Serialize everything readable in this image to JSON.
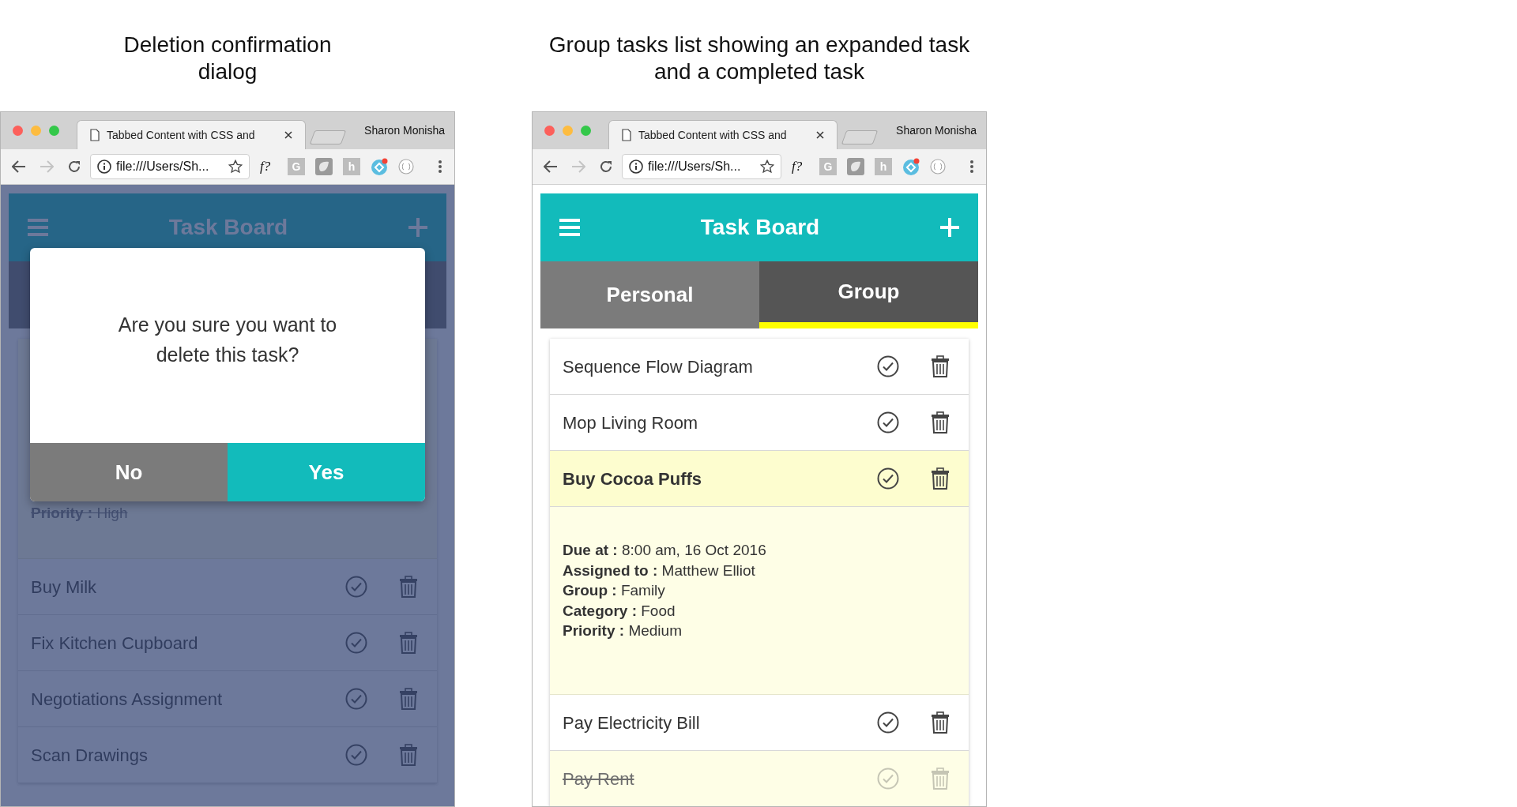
{
  "panels": [
    {
      "caption": "Deletion confirmation dialog",
      "browser": {
        "tab_title": "Tabbed Content with CSS and",
        "profile": "Sharon Monisha",
        "address": "file:///Users/Sh...",
        "extensions": [
          {
            "kind": "text",
            "label": "f?"
          },
          {
            "kind": "tile",
            "label": "G"
          },
          {
            "kind": "shape"
          },
          {
            "kind": "tile",
            "label": "h"
          },
          {
            "kind": "badge"
          },
          {
            "kind": "braces"
          }
        ]
      },
      "app": {
        "title": "Task Board",
        "tasks": [
          {
            "kind": "details",
            "completed": true,
            "details": [
              "**Priority :** High"
            ]
          },
          {
            "kind": "task",
            "title": "Buy Milk",
            "expanded": false,
            "completed": false
          },
          {
            "kind": "task",
            "title": "Fix Kitchen Cupboard",
            "expanded": false,
            "completed": false
          },
          {
            "kind": "task",
            "title": "Negotiations Assignment",
            "expanded": false,
            "completed": false
          },
          {
            "kind": "task",
            "title": "Scan Drawings",
            "expanded": false,
            "completed": false
          }
        ]
      },
      "dialog": {
        "message": "Are you sure you want to delete this task?",
        "buttons": [
          {
            "label": "No",
            "kind": "cancel"
          },
          {
            "label": "Yes",
            "kind": "confirm"
          }
        ]
      }
    },
    {
      "caption": "Group tasks list showing an expanded task and a completed task",
      "browser": {
        "tab_title": "Tabbed Content with CSS and",
        "profile": "Sharon Monisha",
        "address": "file:///Users/Sh...",
        "extensions": [
          {
            "kind": "text",
            "label": "f?"
          },
          {
            "kind": "tile",
            "label": "G"
          },
          {
            "kind": "shape"
          },
          {
            "kind": "tile",
            "label": "h"
          },
          {
            "kind": "badge"
          },
          {
            "kind": "braces"
          }
        ]
      },
      "app": {
        "title": "Task Board",
        "tabs": [
          {
            "label": "Personal",
            "selected": false
          },
          {
            "label": "Group",
            "selected": true
          }
        ],
        "tasks": [
          {
            "kind": "task",
            "title": "Sequence Flow Diagram",
            "expanded": false,
            "completed": false
          },
          {
            "kind": "task",
            "title": "Mop Living Room",
            "expanded": false,
            "completed": false
          },
          {
            "kind": "task",
            "title": "Buy Cocoa Puffs",
            "expanded": true,
            "completed": false,
            "details": [
              "**Due at :** 8:00 am, 16 Oct 2016",
              "**Assigned to :** Matthew Elliot",
              "**Group :** Family",
              "**Category :** Food",
              "**Priority :** Medium"
            ]
          },
          {
            "kind": "task",
            "title": "Pay Electricity Bill",
            "expanded": false,
            "completed": false
          },
          {
            "kind": "task",
            "title": "Pay Rent",
            "expanded": false,
            "completed": true
          }
        ]
      }
    }
  ]
}
